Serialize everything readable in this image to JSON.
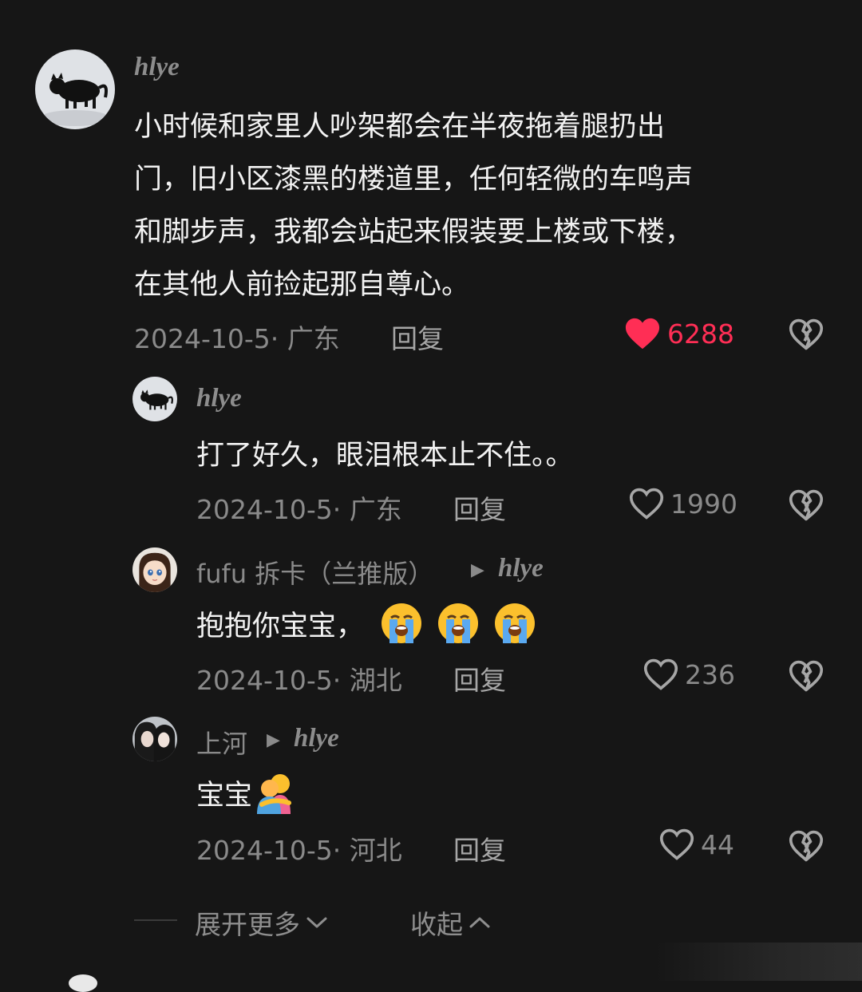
{
  "comments": [
    {
      "username": "hlye",
      "text_lines": [
        "小时候和家里人吵架都会在半夜拖着腿扔出",
        "门，旧小区漆黑的楼道里，任何轻微的车鸣声",
        "和脚步声，我都会站起来假装要上楼或下楼，",
        "在其他人前捡起那自尊心。"
      ],
      "meta": "2024-10-5· 广东",
      "reply_label": "回复",
      "likes": "6288",
      "liked": true
    },
    {
      "username": "hlye",
      "text": "打了好久，眼泪根本止不住。。",
      "meta": "2024-10-5· 广东",
      "reply_label": "回复",
      "likes": "1990"
    },
    {
      "username": "fufu 拆卡（兰推版）",
      "reply_to": "hlye",
      "text": "抱抱你宝宝，",
      "emoji": [
        "loudly-crying-face",
        "loudly-crying-face",
        "loudly-crying-face"
      ],
      "meta": "2024-10-5· 湖北",
      "reply_label": "回复",
      "likes": "236"
    },
    {
      "username": "上河",
      "reply_to": "hlye",
      "text": "宝宝",
      "emoji": [
        "people-hugging"
      ],
      "meta": "2024-10-5· 河北",
      "reply_label": "回复",
      "likes": "44"
    }
  ],
  "footer": {
    "expand_label": "展开更多",
    "collapse_label": "收起"
  },
  "colors": {
    "background": "#161616",
    "like_active": "#ff2e55",
    "text_primary": "#f2f2f2",
    "text_secondary": "#8a8a8a"
  }
}
